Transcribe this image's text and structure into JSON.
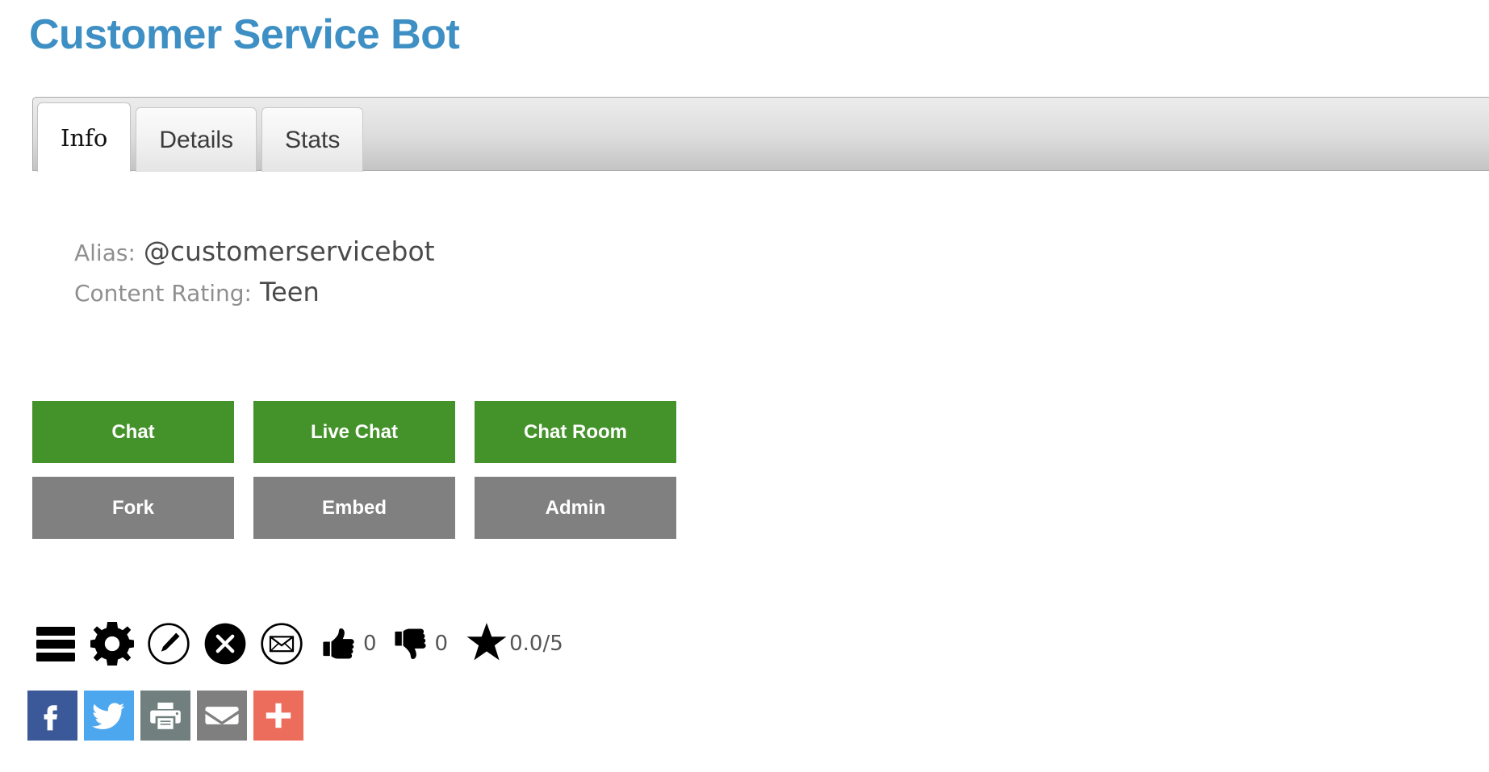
{
  "page": {
    "title": "Customer Service Bot",
    "title_color": "#3d8fc4"
  },
  "tabs": [
    {
      "label": "Info",
      "active": true
    },
    {
      "label": "Details",
      "active": false
    },
    {
      "label": "Stats",
      "active": false
    }
  ],
  "info": {
    "alias_label": "Alias:",
    "alias_value": "@customerservicebot",
    "rating_label": "Content Rating:",
    "rating_value": "Teen"
  },
  "actions": {
    "green_color": "#44922a",
    "gray_color": "#808080",
    "primary_row": [
      {
        "label": "Chat"
      },
      {
        "label": "Live Chat"
      },
      {
        "label": "Chat Room"
      }
    ],
    "secondary_row": [
      {
        "label": "Fork"
      },
      {
        "label": "Embed"
      },
      {
        "label": "Admin"
      }
    ]
  },
  "toolbar": {
    "icons": [
      {
        "name": "menu-icon"
      },
      {
        "name": "gear-icon"
      },
      {
        "name": "edit-pencil-icon"
      },
      {
        "name": "close-circle-icon"
      },
      {
        "name": "envelope-circle-icon"
      }
    ],
    "thumbs_up_count": "0",
    "thumbs_down_count": "0",
    "star_rating": "0.0/5"
  },
  "share": {
    "buttons": [
      {
        "name": "facebook-share-button",
        "color": "#3b5998"
      },
      {
        "name": "twitter-share-button",
        "color": "#4da7ee"
      },
      {
        "name": "print-button",
        "color": "#71807f"
      },
      {
        "name": "email-share-button",
        "color": "#7f7f7f"
      },
      {
        "name": "more-share-button",
        "color": "#ed6d5c"
      }
    ]
  }
}
